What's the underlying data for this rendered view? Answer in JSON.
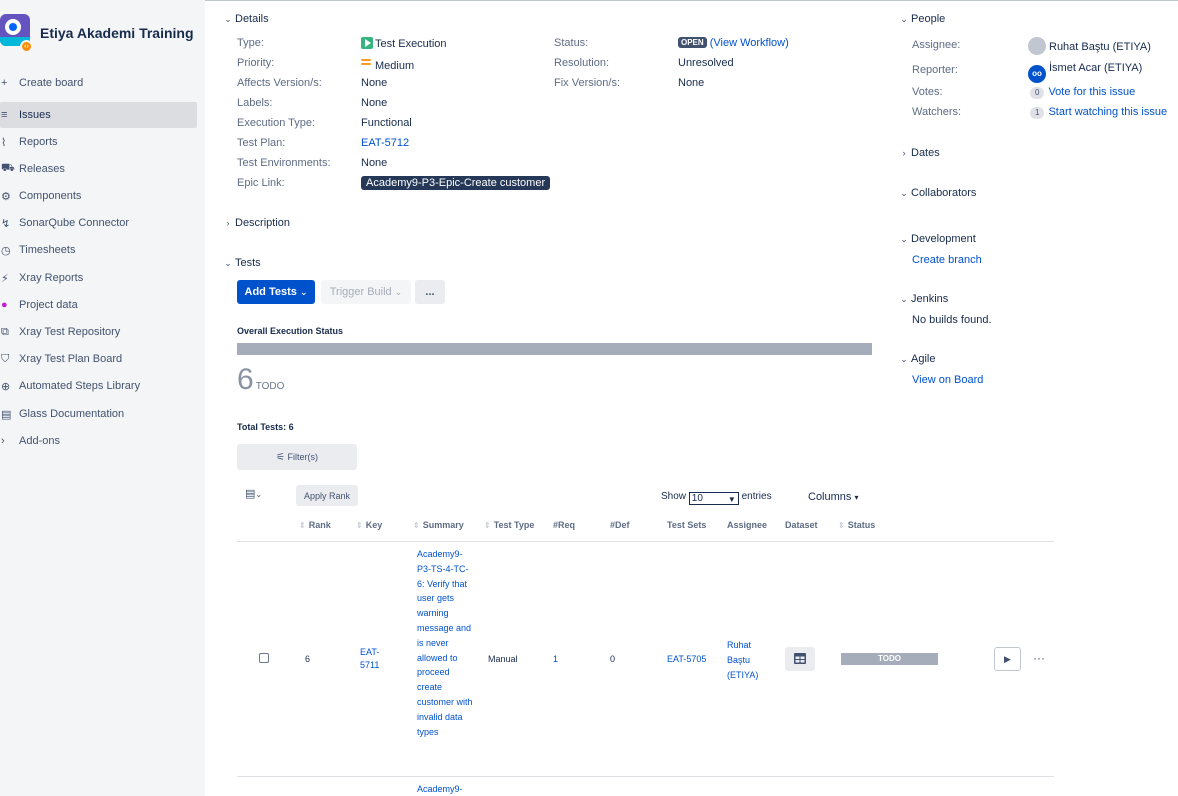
{
  "sidebar": {
    "project_name": "Etiya Akademi Training",
    "items": [
      {
        "label": "Create board",
        "icon": "+"
      },
      {
        "label": "Issues",
        "icon": "≡"
      },
      {
        "label": "Reports",
        "icon": "⌇"
      },
      {
        "label": "Releases",
        "icon": "⛟"
      },
      {
        "label": "Components",
        "icon": "⚙"
      },
      {
        "label": "SonarQube Connector",
        "icon": "↯"
      },
      {
        "label": "Timesheets",
        "icon": "◷"
      },
      {
        "label": "Xray Reports",
        "icon": "⚡"
      },
      {
        "label": "Project data",
        "icon": "●"
      },
      {
        "label": "Xray Test Repository",
        "icon": "⧉"
      },
      {
        "label": "Xray Test Plan Board",
        "icon": "⛉"
      },
      {
        "label": "Automated Steps Library",
        "icon": "⊕"
      },
      {
        "label": "Glass Documentation",
        "icon": "▤"
      },
      {
        "label": "Add-ons",
        "icon": "›"
      }
    ]
  },
  "details": {
    "title": "Details",
    "type_label": "Type:",
    "type_value": "Test Execution",
    "priority_label": "Priority:",
    "priority_value": "Medium",
    "affects_label": "Affects Version/s:",
    "affects_value": "None",
    "labels_label": "Labels:",
    "labels_value": "None",
    "exec_type_label": "Execution Type:",
    "exec_type_value": "Functional",
    "test_plan_label": "Test Plan:",
    "test_plan_value": "EAT-5712",
    "test_env_label": "Test Environments:",
    "test_env_value": "None",
    "epic_label": "Epic Link:",
    "epic_value": "Academy9-P3-Epic-Create customer",
    "status_label": "Status:",
    "status_value": "OPEN",
    "workflow_link": "(View Workflow)",
    "resolution_label": "Resolution:",
    "resolution_value": "Unresolved",
    "fix_label": "Fix Version/s:",
    "fix_value": "None"
  },
  "description": {
    "title": "Description"
  },
  "tests": {
    "title": "Tests",
    "add_tests": "Add Tests",
    "trigger_build": "Trigger Build",
    "more": "...",
    "overall_status_label": "Overall Execution Status",
    "todo_count": "6",
    "todo_label": "TODO",
    "total_tests": "Total Tests: 6",
    "filter": "Filter(s)",
    "apply_rank": "Apply Rank",
    "show_label": "Show",
    "show_value": "10",
    "entries_label": "entries",
    "columns_label": "Columns",
    "columns": [
      "Rank",
      "Key",
      "Summary",
      "Test Type",
      "#Req",
      "#Def",
      "Test Sets",
      "Assignee",
      "Dataset",
      "Status"
    ],
    "rows": [
      {
        "rank": "6",
        "key": "EAT-5711",
        "summary": "Academy9-P3-TS-4-TC-6: Verify that user gets warning message and is never allowed to proceed create customer with invalid data types",
        "test_type": "Manual",
        "req": "1",
        "def": "0",
        "test_sets": "EAT-5705",
        "assignee": "Ruhat Baştu (ETIYA)",
        "status": "TODO"
      },
      {
        "summary": "Academy9-"
      }
    ]
  },
  "people": {
    "title": "People",
    "assignee_label": "Assignee:",
    "assignee_value": "Ruhat Baştu (ETIYA)",
    "reporter_label": "Reporter:",
    "reporter_value": "İsmet Acar (ETIYA)",
    "votes_label": "Votes:",
    "votes_count": "0",
    "votes_link": "Vote for this issue",
    "watchers_label": "Watchers:",
    "watchers_count": "1",
    "watchers_link": "Start watching this issue"
  },
  "dates": {
    "title": "Dates"
  },
  "collaborators": {
    "title": "Collaborators"
  },
  "development": {
    "title": "Development",
    "create_branch": "Create branch"
  },
  "jenkins": {
    "title": "Jenkins",
    "no_builds": "No builds found."
  },
  "agile": {
    "title": "Agile",
    "view_on_board": "View on Board"
  }
}
